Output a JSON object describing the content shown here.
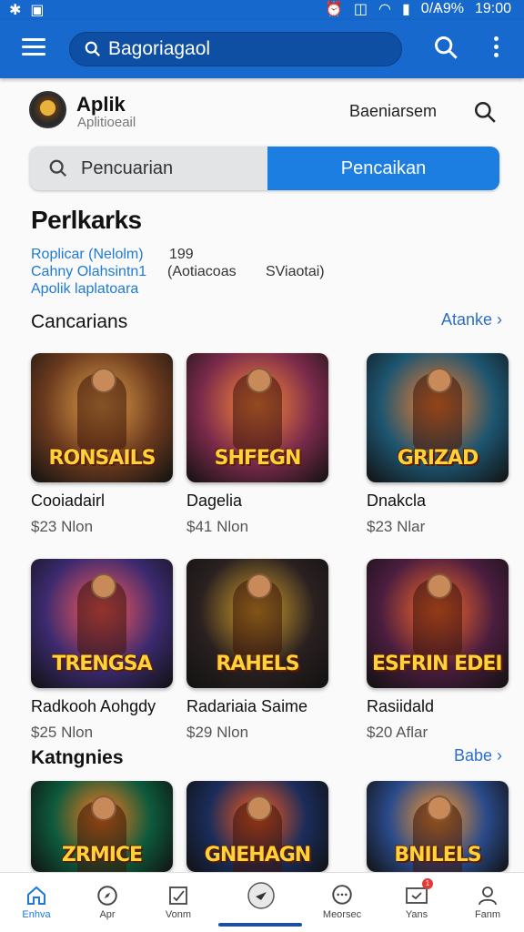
{
  "status": {
    "battery": "0/Ѧ9%",
    "time": "19:00"
  },
  "search": {
    "value": "Bagoriagaol"
  },
  "profile": {
    "name": "Aplik",
    "subtitle": "Aplitioeail",
    "link": "Baeniarsem"
  },
  "tabs": {
    "left_label": "Pencuarian",
    "right_label": "Pencaikan"
  },
  "section": {
    "title": "Perlkarks",
    "links": [
      {
        "text": "Roplicar (Nelolm)",
        "extra": "199"
      },
      {
        "text": "Cahny Olahsintn1",
        "extra": "(Aotiacoas",
        "extra2": "SViaotai)"
      },
      {
        "text": "Apolik laplatoara",
        "extra": ""
      }
    ]
  },
  "row1": {
    "title": "Cancarians",
    "more": "Atanke",
    "cards": [
      {
        "title": "Cooiadairl",
        "price": "$23 Nlon",
        "logo": "RONSAILS",
        "bg": "#6b3a1e",
        "accent": "#e0a04a"
      },
      {
        "title": "Dagelia",
        "price": "$41 Nlon",
        "logo": "SHFEGN",
        "bg": "#7a2a4a",
        "accent": "#ff8a3a"
      },
      {
        "title": "Dnakcla",
        "price": "$23 Nlar",
        "logo": "GRIZAD",
        "bg": "#1d5570",
        "accent": "#ff7f2a"
      }
    ]
  },
  "row2": {
    "cards": [
      {
        "title": "Radkooh Aohgdy",
        "price": "$25 Nlon",
        "logo": "TRENGSA",
        "bg": "#3b2a6e",
        "accent": "#ff5a5a"
      },
      {
        "title": "Radariaia Saime",
        "price": "$29 Nlon",
        "logo": "RAHELS",
        "bg": "#2a2020",
        "accent": "#d6a32a"
      },
      {
        "title": "Rasiidald",
        "price": "$20 Aflar",
        "logo": "ESFRIN EDEIN",
        "bg": "#4a1d3e",
        "accent": "#ff6b2a"
      }
    ]
  },
  "row3": {
    "title": "Katngnies",
    "more": "Babe",
    "cards": [
      {
        "logo": "ZRMICE",
        "bg": "#0d5a3c",
        "accent": "#ff7a1a"
      },
      {
        "logo": "GNEHAGN",
        "bg": "#1a2c5a",
        "accent": "#ff5a1a"
      },
      {
        "logo": "BNILELS",
        "bg": "#2a4a8a",
        "accent": "#ff9a2a"
      }
    ]
  },
  "nav": [
    {
      "label": "Enhva",
      "icon": "home-icon"
    },
    {
      "label": "Apr",
      "icon": "compass-icon"
    },
    {
      "label": "Vonm",
      "icon": "edit-icon"
    },
    {
      "label": "",
      "icon": "center-action-icon"
    },
    {
      "label": "Meorsec",
      "icon": "chat-icon"
    },
    {
      "label": "Yans",
      "icon": "notifications-icon",
      "badge": "1"
    },
    {
      "label": "Fanm",
      "icon": "profile-icon"
    }
  ],
  "colors": {
    "primary": "#1769ce",
    "accent": "#1b7ee0",
    "link": "#1f7ad6"
  }
}
